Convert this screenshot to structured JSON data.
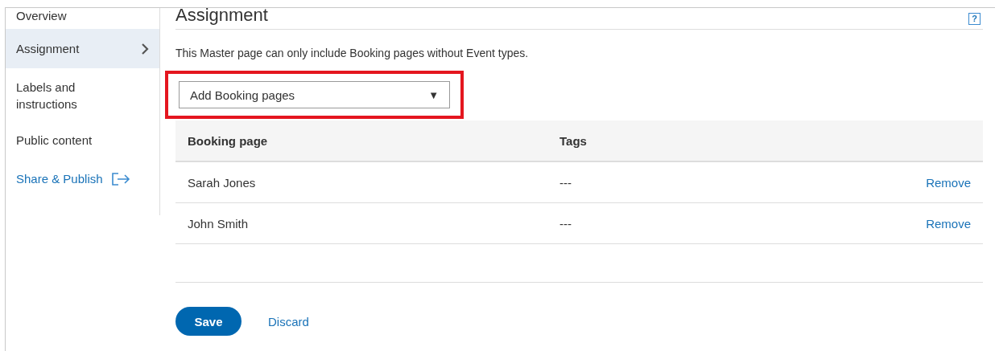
{
  "sidebar": {
    "items": [
      {
        "label": "Overview",
        "selected": false,
        "kind": "plain"
      },
      {
        "label": "Assignment",
        "selected": true,
        "kind": "plain"
      },
      {
        "label": "Labels and instructions",
        "selected": false,
        "kind": "plain"
      },
      {
        "label": "Public content",
        "selected": false,
        "kind": "plain"
      },
      {
        "label": "Share & Publish",
        "selected": false,
        "kind": "link"
      }
    ]
  },
  "main": {
    "title": "Assignment",
    "help": "?",
    "description": "This Master page can only include Booking pages without Event types.",
    "dropdown": {
      "value": "Add Booking pages",
      "arrow": "▼",
      "highlighted": true
    },
    "table": {
      "columns": [
        "Booking page",
        "Tags"
      ],
      "rows": [
        {
          "booking_page": "Sarah Jones",
          "tags": "---",
          "action": "Remove"
        },
        {
          "booking_page": "John Smith",
          "tags": "---",
          "action": "Remove"
        }
      ]
    },
    "buttons": {
      "save": "Save",
      "discard": "Discard"
    }
  }
}
